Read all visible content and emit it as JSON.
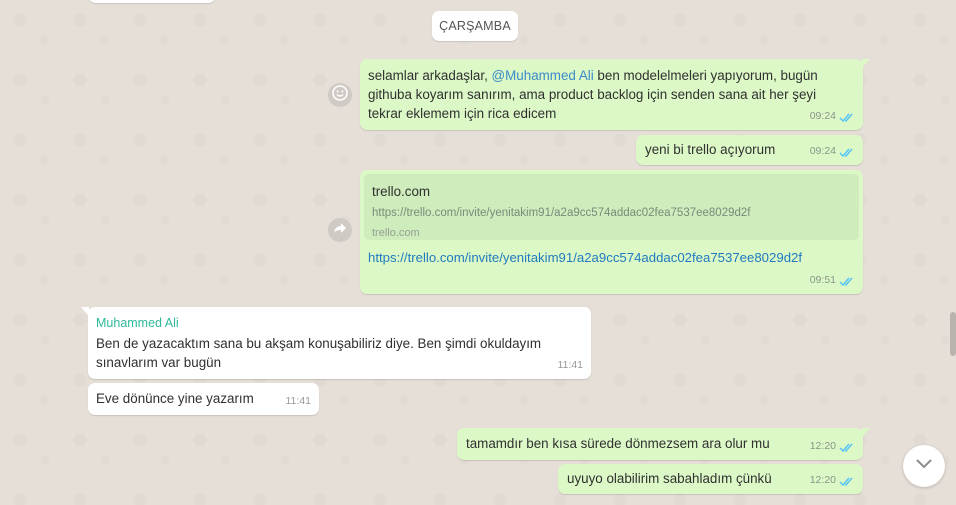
{
  "date_chip": "ÇARŞAMBA",
  "messages": {
    "m1": {
      "pre": "selamlar arkadaşlar, ",
      "mention": "@Muhammed Ali",
      "line1_rest": " ben modelelmeleri yapıyorum, bugün",
      "line2": "githuba koyarım sanırım, ama product backlog için senden sana ait her şeyi",
      "line3": "tekrar eklemem için rica edicem",
      "time": "09:24"
    },
    "m2": {
      "text": "yeni bi trello açıyorum",
      "time": "09:24"
    },
    "m3": {
      "preview_title": "trello.com",
      "preview_url": "https://trello.com/invite/yenitakim91/a2a9cc574addac02fea7537ee8029d2f",
      "preview_domain": "trello.com",
      "link": "https://trello.com/invite/yenitakim91/a2a9cc574addac02fea7537ee8029d2f",
      "time": "09:51"
    },
    "m4": {
      "sender": "Muhammed Ali",
      "line1": "Ben de yazacaktım sana bu akşam konuşabiliriz diye. Ben şimdi okuldayım",
      "line2": "sınavlarım var bugün",
      "time": "11:41"
    },
    "m5": {
      "text": "Eve dönünce yine yazarım",
      "time": "11:41"
    },
    "m6": {
      "text": "tamamdır ben kısa sürede dönmezsem ara olur mu",
      "time": "12:20"
    },
    "m7": {
      "text": "uyuyo olabilirim sabahladım çünkü",
      "time": "12:20"
    }
  },
  "icons": {
    "emoji_reaction": "smiley-icon",
    "forward": "forward-icon",
    "read_receipt": "double-check-icon",
    "scroll_down": "chevron-down-icon"
  },
  "colors": {
    "outgoing_bubble": "#dcf8c6",
    "incoming_bubble": "#ffffff",
    "read_ticks": "#4fc3f7",
    "sender_name": "#2fb89a",
    "mention": "#3a8bc8"
  }
}
